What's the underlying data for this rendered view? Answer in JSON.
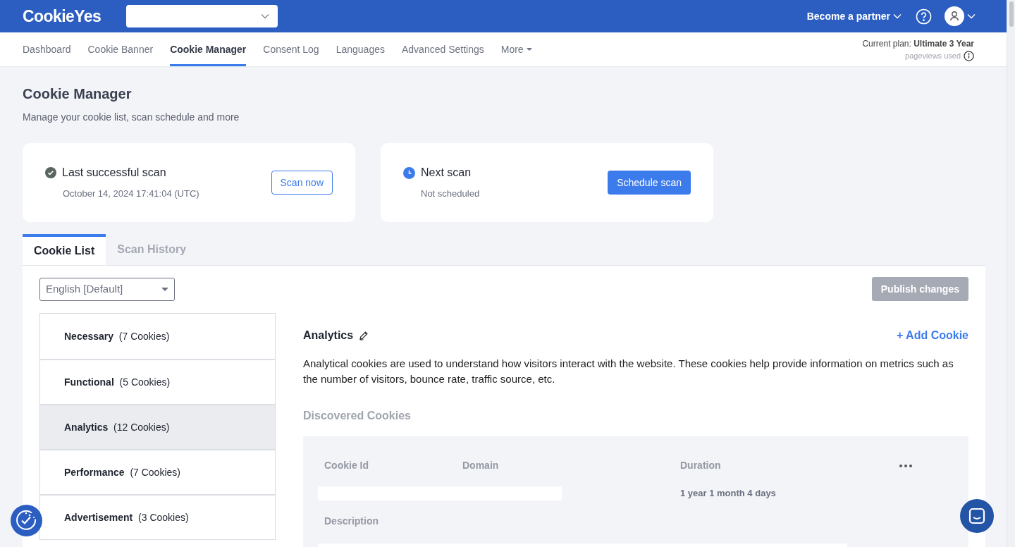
{
  "header": {
    "logo": "CookieYes",
    "partner_link": "Become a partner"
  },
  "nav": {
    "items": [
      {
        "label": "Dashboard",
        "selected": false
      },
      {
        "label": "Cookie Banner",
        "selected": false
      },
      {
        "label": "Cookie Manager",
        "selected": true
      },
      {
        "label": "Consent Log",
        "selected": false
      },
      {
        "label": "Languages",
        "selected": false
      },
      {
        "label": "Advanced Settings",
        "selected": false
      }
    ],
    "more": "More"
  },
  "plan": {
    "label": "Current plan:",
    "name": "Ultimate 3 Year",
    "usage": "pageviews used"
  },
  "page": {
    "title": "Cookie Manager",
    "subtitle": "Manage your cookie list, scan schedule and more"
  },
  "scan_cards": [
    {
      "kind": "last",
      "title": "Last successful scan",
      "subtitle": "October 14, 2024 17:41:04 (UTC)",
      "button": "Scan now"
    },
    {
      "kind": "next",
      "title": "Next scan",
      "subtitle": "Not scheduled",
      "button": "Schedule scan"
    }
  ],
  "tabs": [
    {
      "label": "Cookie List",
      "selected": true
    },
    {
      "label": "Scan History",
      "selected": false
    }
  ],
  "language_select": {
    "value": "English [Default]"
  },
  "publish_button": {
    "label": "Publish changes",
    "disabled": true
  },
  "categories": [
    {
      "name": "Necessary",
      "count": "(7 Cookies)",
      "selected": false
    },
    {
      "name": "Functional",
      "count": "(5 Cookies)",
      "selected": false
    },
    {
      "name": "Analytics",
      "count": "(12 Cookies)",
      "selected": true
    },
    {
      "name": "Performance",
      "count": "(7 Cookies)",
      "selected": false
    },
    {
      "name": "Advertisement",
      "count": "(3 Cookies)",
      "selected": false
    }
  ],
  "detail": {
    "title": "Analytics",
    "add_button": "+ Add Cookie",
    "description": "Analytical cookies are used to understand how visitors interact with the website. These cookies help provide information on metrics such as the number of visitors, bounce rate, traffic source, etc.",
    "section_title": "Discovered Cookies",
    "table": {
      "columns": [
        "Cookie Id",
        "Domain",
        "Duration"
      ],
      "duration": "1 year 1 month 4 days",
      "description_label": "Description"
    }
  }
}
